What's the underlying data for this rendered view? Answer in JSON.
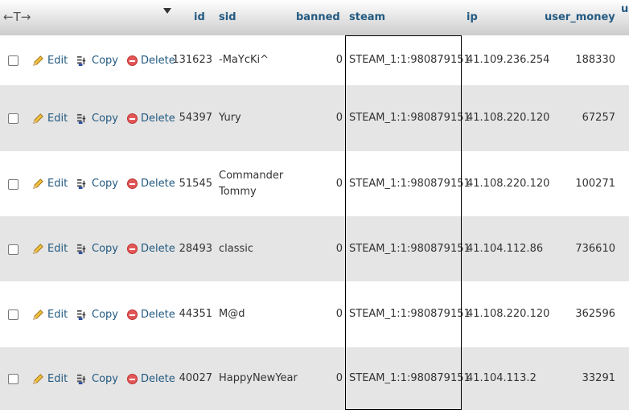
{
  "header": {
    "arrows": "←T→",
    "columns": {
      "id": "id",
      "sid": "sid",
      "banned": "banned",
      "steam": "steam",
      "ip": "ip",
      "user_money": "user_money",
      "cut": "u:"
    }
  },
  "actions": {
    "edit": "Edit",
    "copy": "Copy",
    "delete": "Delete"
  },
  "rows": [
    {
      "id": "131623",
      "sid": "-MaYcKi^",
      "banned": "0",
      "steam": "STEAM_1:1:980879151",
      "ip": "41.109.236.254",
      "user_money": "188330"
    },
    {
      "id": "54397",
      "sid": "Yury",
      "banned": "0",
      "steam": "STEAM_1:1:980879151",
      "ip": "41.108.220.120",
      "user_money": "67257"
    },
    {
      "id": "51545",
      "sid": "Commander Tommy",
      "banned": "0",
      "steam": "STEAM_1:1:980879151",
      "ip": "41.108.220.120",
      "user_money": "100271"
    },
    {
      "id": "28493",
      "sid": "classic",
      "banned": "0",
      "steam": "STEAM_1:1:980879151",
      "ip": "41.104.112.86",
      "user_money": "736610"
    },
    {
      "id": "44351",
      "sid": "M@d",
      "banned": "0",
      "steam": "STEAM_1:1:980879151",
      "ip": "41.108.220.120",
      "user_money": "362596"
    },
    {
      "id": "40027",
      "sid": "HappyNewYear",
      "banned": "0",
      "steam": "STEAM_1:1:980879151",
      "ip": "41.104.113.2",
      "user_money": "33291"
    }
  ]
}
